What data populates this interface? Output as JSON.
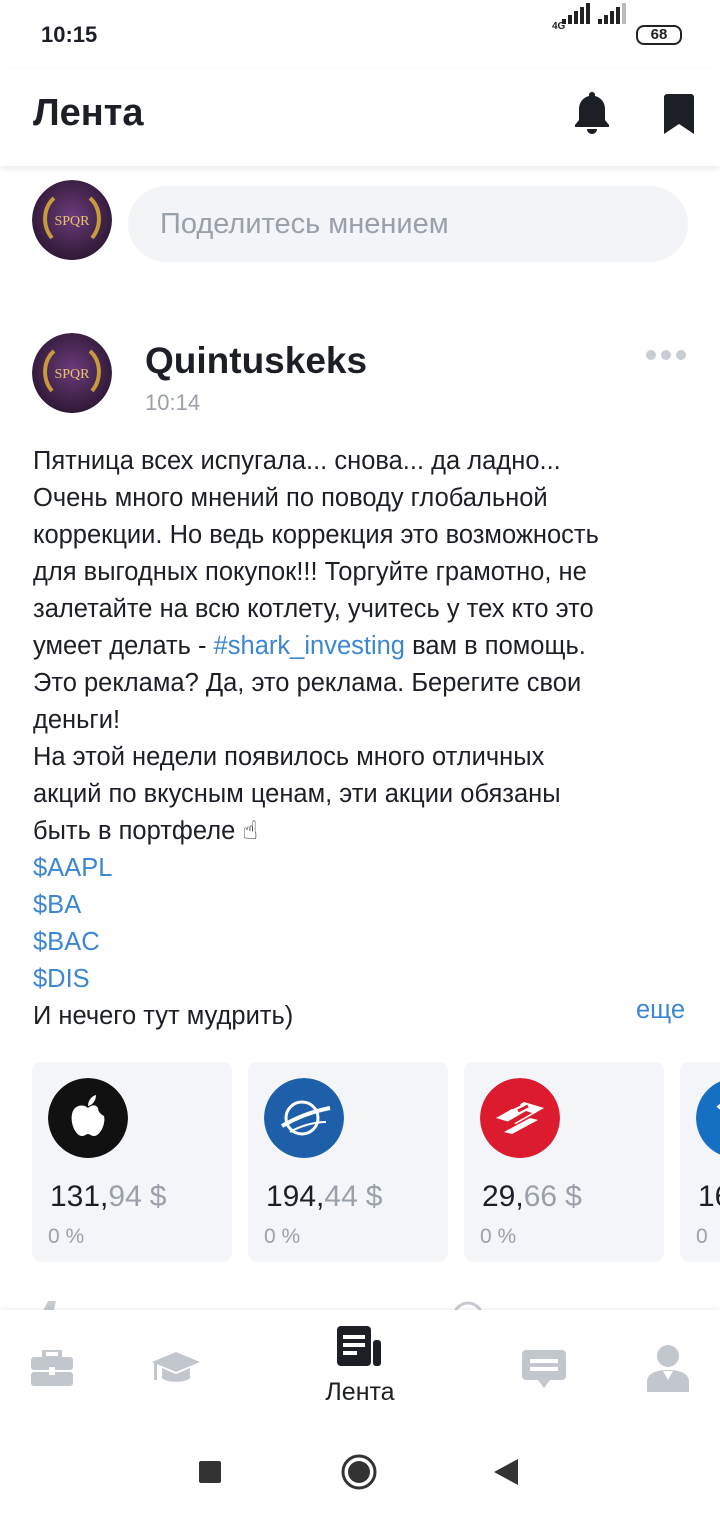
{
  "status_bar": {
    "time": "10:15",
    "network": "4G",
    "battery": "68"
  },
  "header": {
    "title": "Лента",
    "icons": [
      "bell-icon",
      "bookmark-icon"
    ]
  },
  "composer": {
    "placeholder": "Поделитесь мнением",
    "avatar_text": "SPQR"
  },
  "post": {
    "author": "Quintuskeks",
    "time": "10:14",
    "avatar_text": "SPQR",
    "body_lines": [
      "Пятница всех испугала... снова... да ладно...",
      "Очень много мнений по поводу глобальной",
      "коррекции. Но ведь коррекция это возможность",
      "для выгодных покупок!!! Торгуйте грамотно, не",
      "залетайте на всю котлету, учитесь у тех кто это",
      "умеет делать - ",
      " вам в помощь.",
      "Это реклама? Да, это реклама. Берегите свои",
      "деньги!",
      "На этой недели появилось много отличных",
      "акций по вкусным ценам, эти акции обязаны",
      "быть в портфеле ☝",
      "И нечего тут мудрить)"
    ],
    "hashtag": "#shark_investing",
    "tickers": [
      "$AAPL",
      "$BA",
      "$BAC",
      "$DIS"
    ],
    "more_label": "еще"
  },
  "ticker_cards": [
    {
      "symbol": "AAPL",
      "price_int": "131,",
      "price_frac": "94",
      "currency": "$",
      "change": "0 %",
      "logo": "apple-logo",
      "logo_bg": "#111111"
    },
    {
      "symbol": "BA",
      "price_int": "194,",
      "price_frac": "44",
      "currency": "$",
      "change": "0 %",
      "logo": "boeing-logo",
      "logo_bg": "#1d5fa8"
    },
    {
      "symbol": "BAC",
      "price_int": "29,",
      "price_frac": "66",
      "currency": "$",
      "change": "0 %",
      "logo": "bank-of-america-logo",
      "logo_bg": "#dc1c2e"
    },
    {
      "symbol": "DIS",
      "price_int": "16",
      "price_frac": "",
      "currency": "",
      "change": "0",
      "logo": "disney-logo",
      "logo_bg": "#1570c4"
    }
  ],
  "bottom_nav": {
    "items": [
      {
        "name": "portfolio",
        "icon": "briefcase-icon",
        "label": ""
      },
      {
        "name": "education",
        "icon": "graduation-cap-icon",
        "label": ""
      },
      {
        "name": "feed",
        "icon": "feed-icon",
        "label": "Лента",
        "active": true
      },
      {
        "name": "chat",
        "icon": "chat-icon",
        "label": ""
      },
      {
        "name": "profile",
        "icon": "profile-icon",
        "label": ""
      }
    ]
  },
  "colors": {
    "accent_link": "#3d86d1",
    "text_primary": "#1c1f26",
    "text_muted": "#9aa0aa",
    "card_bg": "#f3f5f8",
    "nav_inactive": "#c2c6cd"
  }
}
